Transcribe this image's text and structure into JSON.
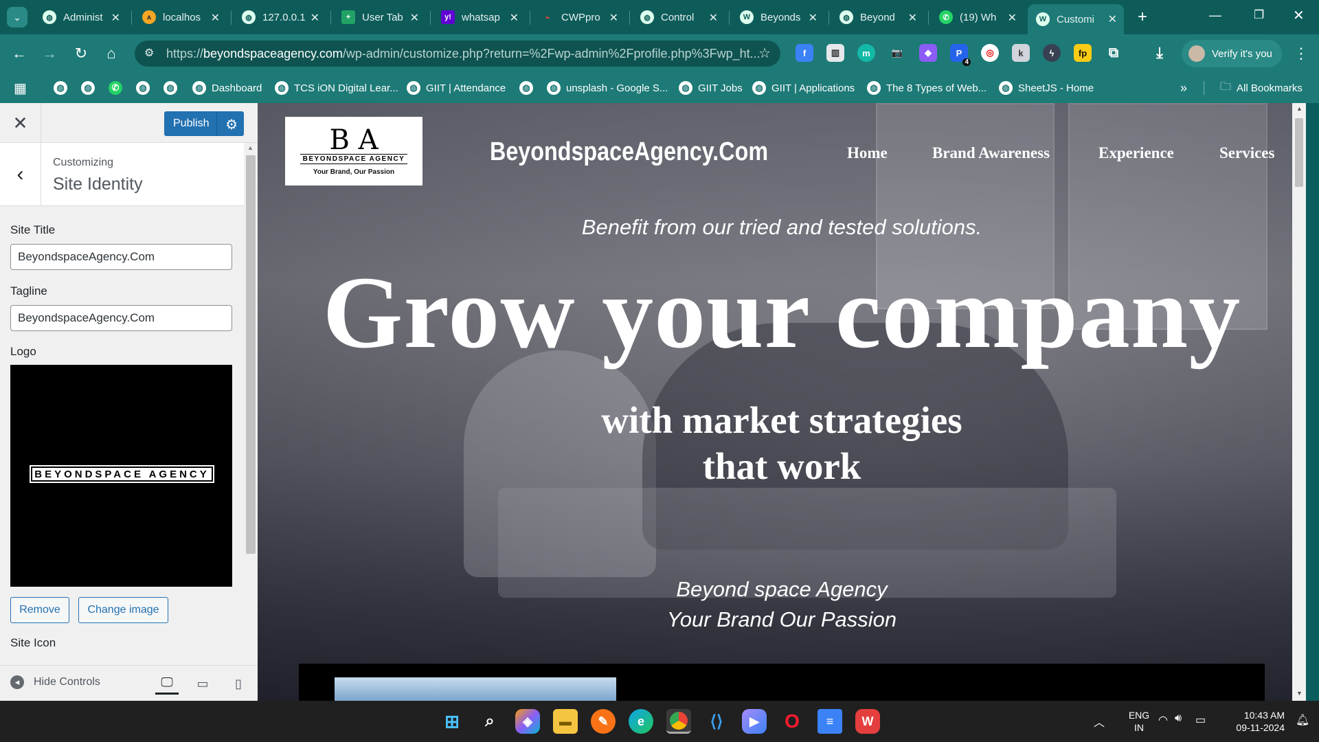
{
  "tabs": [
    {
      "title": "Administ",
      "icon": "globe-icon"
    },
    {
      "title": "localhos",
      "icon": "xampp-icon"
    },
    {
      "title": "127.0.0.1",
      "icon": "globe-icon"
    },
    {
      "title": "User Tab",
      "icon": "sheets-icon"
    },
    {
      "title": "whatsap",
      "icon": "yahoo-icon"
    },
    {
      "title": "CWPpro",
      "icon": "cwp-icon"
    },
    {
      "title": "Control",
      "icon": "globe-icon"
    },
    {
      "title": "Beyonds",
      "icon": "wordpress-icon"
    },
    {
      "title": "Beyond",
      "icon": "globe-icon"
    },
    {
      "title": "(19) Wh",
      "icon": "whatsapp-icon"
    },
    {
      "title": "Customi",
      "icon": "wordpress-icon"
    }
  ],
  "address": {
    "scheme": "https://",
    "domain": "beyondspaceagency.com",
    "path": "/wp-admin/customize.php?return=%2Fwp-admin%2Fprofile.php%3Fwp_ht..."
  },
  "verify_label": "Verify it's you",
  "extension_badge": "4",
  "bookmarks": [
    {
      "label": "Dashboard"
    },
    {
      "label": "TCS iON Digital Lear..."
    },
    {
      "label": "GIIT | Attendance"
    },
    {
      "label": "unsplash - Google S..."
    },
    {
      "label": "GIIT Jobs"
    },
    {
      "label": "GIIT | Applications"
    },
    {
      "label": "The 8 Types of Web..."
    },
    {
      "label": "SheetJS - Home"
    }
  ],
  "all_bookmarks": "All Bookmarks",
  "customizer": {
    "publish": "Publish",
    "customizing": "Customizing",
    "section": "Site Identity",
    "site_title_label": "Site Title",
    "site_title_value": "BeyondspaceAgency.Com",
    "tagline_label": "Tagline",
    "tagline_value": "BeyondspaceAgency.Com",
    "logo_label": "Logo",
    "logo_text": "BEYONDSPACE AGENCY",
    "remove": "Remove",
    "change_image": "Change image",
    "site_icon_label": "Site Icon",
    "hide_controls": "Hide Controls"
  },
  "site": {
    "logo_monogram": "B A",
    "logo_name": "BEYONDSPACE AGENCY",
    "logo_tagline": "Your Brand, Our Passion",
    "title": "BeyondspaceAgency.Com",
    "nav": [
      "Home",
      "Brand Awareness",
      "Experience",
      "Services"
    ],
    "benefit": "Benefit from our tried and tested solutions.",
    "headline": "Grow your company",
    "sub1": "with market strategies",
    "sub2": "that work",
    "agency_line1": "Beyond space Agency",
    "agency_line2": "Your Brand Our Passion"
  },
  "tray": {
    "lang1": "ENG",
    "lang2": "IN",
    "time": "10:43 AM",
    "date": "09-11-2024"
  },
  "colors": {
    "browser_frame": "#0d5c5a",
    "toolbar": "#1d7a77",
    "wp_blue": "#2271b1"
  }
}
